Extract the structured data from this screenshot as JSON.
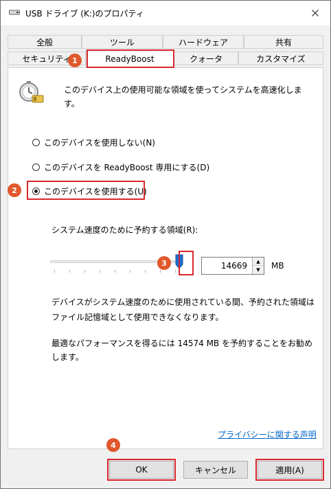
{
  "window": {
    "title": "USB ドライブ (K:)のプロパティ",
    "drive_icon": "usb-drive-icon",
    "close_icon": "close-icon"
  },
  "tabs": {
    "row1": [
      "全般",
      "ツール",
      "ハードウェア",
      "共有"
    ],
    "row2": [
      "セキュリティ",
      "ReadyBoost",
      "クォータ",
      "カスタマイズ"
    ],
    "active": "ReadyBoost"
  },
  "panel": {
    "intro_icon": "readyboost-stopwatch-icon",
    "intro_line1": "このデバイス上の使用可能な領域を使ってシステムを高速化しま",
    "intro_line2": "す。",
    "options": [
      {
        "label": "このデバイスを使用しない(N)",
        "selected": false
      },
      {
        "label": "このデバイスを ReadyBoost 専用にする(D)",
        "selected": false
      },
      {
        "label": "このデバイスを使用する(U)",
        "selected": true
      }
    ],
    "reserve_label": "システム速度のために予約する領域(R):",
    "reserve_value": "14669",
    "reserve_unit": "MB",
    "slider_level": 0.98,
    "info_line1": "デバイスがシステム速度のために使用されている間、予約された領域は",
    "info_line2": "ファイル記憶域として使用できなくなります。",
    "recommend_line1": "最適なパフォーマンスを得るには 14574 MB を予約することをお勧め",
    "recommend_line2": "します。",
    "privacy_link": "プライバシーに関する声明"
  },
  "buttons": {
    "ok": "OK",
    "cancel": "キャンセル",
    "apply": "適用(A)"
  },
  "callouts": [
    "1",
    "2",
    "3",
    "4"
  ],
  "colors": {
    "callout": "#e0582c",
    "highlight_box": "#d9272e",
    "slider_thumb": "#1e6fd1",
    "link": "#0066cc"
  }
}
